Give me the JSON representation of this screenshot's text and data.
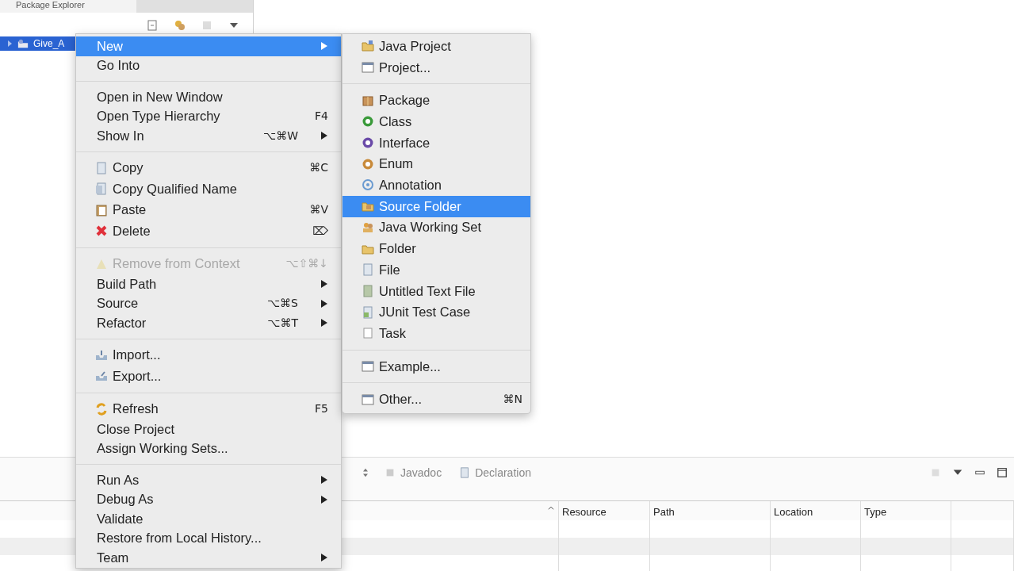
{
  "explorer": {
    "title": "Package Explorer",
    "tree": [
      {
        "label": "Give_A",
        "selected": true,
        "expanded": false
      }
    ]
  },
  "context_menu": {
    "items": [
      {
        "kind": "item",
        "label": "New",
        "submenu": true,
        "selected": true,
        "disabled": false
      },
      {
        "kind": "item",
        "label": "Go Into",
        "submenu": false,
        "selected": false,
        "disabled": false
      },
      {
        "kind": "separator"
      },
      {
        "kind": "item",
        "label": "Open in New Window",
        "submenu": false,
        "selected": false,
        "disabled": false
      },
      {
        "kind": "item",
        "label": "Open Type Hierarchy",
        "shortcut": "F4",
        "submenu": false,
        "selected": false,
        "disabled": false
      },
      {
        "kind": "item",
        "label": "Show In",
        "shortcut": "⌥⌘W",
        "submenu": true,
        "selected": false,
        "disabled": false
      },
      {
        "kind": "separator"
      },
      {
        "kind": "icon-item",
        "label": "Copy",
        "shortcut": "⌘C",
        "submenu": false,
        "selected": false,
        "disabled": false
      },
      {
        "kind": "icon-item",
        "label": "Copy Qualified Name",
        "submenu": false,
        "selected": false,
        "disabled": false
      },
      {
        "kind": "icon-item",
        "label": "Paste",
        "shortcut": "⌘V",
        "submenu": false,
        "selected": false,
        "disabled": false
      },
      {
        "kind": "icon-item",
        "label": "Delete",
        "shortcut": "⌦",
        "submenu": false,
        "selected": false,
        "disabled": false
      },
      {
        "kind": "separator"
      },
      {
        "kind": "icon-item",
        "label": "Remove from Context",
        "shortcut": "⌥⇧⌘↓",
        "submenu": false,
        "selected": false,
        "disabled": true
      },
      {
        "kind": "item",
        "label": "Build Path",
        "submenu": true,
        "selected": false,
        "disabled": false
      },
      {
        "kind": "item",
        "label": "Source",
        "shortcut": "⌥⌘S",
        "submenu": true,
        "selected": false,
        "disabled": false
      },
      {
        "kind": "item",
        "label": "Refactor",
        "shortcut": "⌥⌘T",
        "submenu": true,
        "selected": false,
        "disabled": false
      },
      {
        "kind": "separator"
      },
      {
        "kind": "icon-item",
        "label": "Import...",
        "submenu": false,
        "selected": false,
        "disabled": false
      },
      {
        "kind": "icon-item",
        "label": "Export...",
        "submenu": false,
        "selected": false,
        "disabled": false
      },
      {
        "kind": "separator"
      },
      {
        "kind": "icon-item",
        "label": "Refresh",
        "shortcut": "F5",
        "submenu": false,
        "selected": false,
        "disabled": false
      },
      {
        "kind": "item",
        "label": "Close Project",
        "submenu": false,
        "selected": false,
        "disabled": false
      },
      {
        "kind": "item",
        "label": "Assign Working Sets...",
        "submenu": false,
        "selected": false,
        "disabled": false
      },
      {
        "kind": "separator"
      },
      {
        "kind": "item",
        "label": "Run As",
        "submenu": true,
        "selected": false,
        "disabled": false
      },
      {
        "kind": "item",
        "label": "Debug As",
        "submenu": true,
        "selected": false,
        "disabled": false
      },
      {
        "kind": "item",
        "label": "Validate",
        "submenu": false,
        "selected": false,
        "disabled": false
      },
      {
        "kind": "item",
        "label": "Restore from Local History...",
        "submenu": false,
        "selected": false,
        "disabled": false
      },
      {
        "kind": "item",
        "label": "Team",
        "submenu": true,
        "selected": false,
        "disabled": false
      }
    ]
  },
  "submenu": {
    "items": [
      {
        "kind": "icon-item",
        "label": "Java Project",
        "selected": false
      },
      {
        "kind": "icon-item",
        "label": "Project...",
        "selected": false
      },
      {
        "kind": "separator"
      },
      {
        "kind": "icon-item",
        "label": "Package",
        "selected": false
      },
      {
        "kind": "icon-item",
        "label": "Class",
        "selected": false
      },
      {
        "kind": "icon-item",
        "label": "Interface",
        "selected": false
      },
      {
        "kind": "icon-item",
        "label": "Enum",
        "selected": false
      },
      {
        "kind": "icon-item",
        "label": "Annotation",
        "selected": false
      },
      {
        "kind": "icon-item",
        "label": "Source Folder",
        "selected": true
      },
      {
        "kind": "icon-item",
        "label": "Java Working Set",
        "selected": false
      },
      {
        "kind": "icon-item",
        "label": "Folder",
        "selected": false
      },
      {
        "kind": "icon-item",
        "label": "File",
        "selected": false
      },
      {
        "kind": "icon-item",
        "label": "Untitled Text File",
        "selected": false
      },
      {
        "kind": "icon-item",
        "label": "JUnit Test Case",
        "selected": false
      },
      {
        "kind": "icon-item",
        "label": "Task",
        "selected": false
      },
      {
        "kind": "separator"
      },
      {
        "kind": "icon-item",
        "label": "Example...",
        "selected": false
      },
      {
        "kind": "separator"
      },
      {
        "kind": "icon-item",
        "label": "Other...",
        "shortcut": "⌘N",
        "selected": false
      }
    ]
  },
  "bottom_panel": {
    "tabs": [
      {
        "label": "Javadoc",
        "selected": false
      },
      {
        "label": "Declaration",
        "selected": false
      }
    ],
    "table": {
      "columns": [
        "Resource",
        "Path",
        "Location",
        "Type"
      ]
    }
  }
}
